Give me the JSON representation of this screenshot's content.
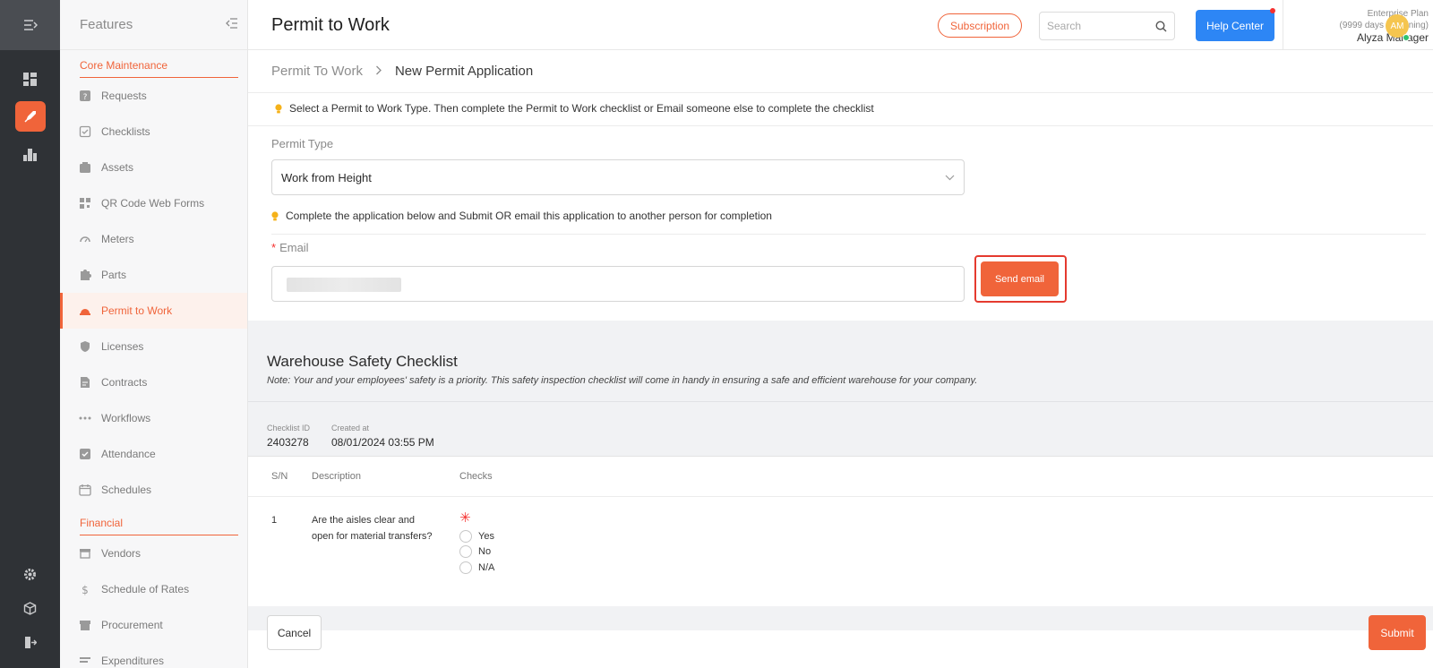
{
  "rail": {
    "menu_icon": "collapse-menu-icon",
    "items": [
      {
        "icon": "dashboard-icon",
        "active": false
      },
      {
        "icon": "rocket-icon",
        "active": true
      },
      {
        "icon": "analytics-icon",
        "active": false
      }
    ],
    "bottom_items": [
      "settings-icon",
      "cube-icon",
      "logout-icon"
    ]
  },
  "sidebar": {
    "title": "Features",
    "sections": [
      {
        "label": "Core Maintenance",
        "items": [
          {
            "label": "Requests",
            "icon": "question-icon"
          },
          {
            "label": "Checklists",
            "icon": "checklist-icon"
          },
          {
            "label": "Assets",
            "icon": "asset-icon"
          },
          {
            "label": "QR Code Web Forms",
            "icon": "qr-code-icon"
          },
          {
            "label": "Meters",
            "icon": "meter-icon"
          },
          {
            "label": "Parts",
            "icon": "puzzle-icon"
          },
          {
            "label": "Permit to Work",
            "icon": "hard-hat-icon",
            "active": true
          },
          {
            "label": "Licenses",
            "icon": "shield-icon"
          },
          {
            "label": "Contracts",
            "icon": "contract-icon"
          },
          {
            "label": "Workflows",
            "icon": "workflow-icon"
          },
          {
            "label": "Attendance",
            "icon": "attendance-icon"
          },
          {
            "label": "Schedules",
            "icon": "calendar-icon"
          }
        ]
      },
      {
        "label": "Financial",
        "items": [
          {
            "label": "Vendors",
            "icon": "vendor-icon"
          },
          {
            "label": "Schedule of Rates",
            "icon": "dollar-icon"
          },
          {
            "label": "Procurement",
            "icon": "store-icon"
          },
          {
            "label": "Expenditures",
            "icon": "expenditure-icon"
          }
        ]
      }
    ]
  },
  "header": {
    "title": "Permit to Work",
    "subscription_label": "Subscription",
    "search_placeholder": "Search",
    "help_label": "Help Center",
    "plan_name": "Enterprise Plan",
    "plan_days": "(9999 days remaining)",
    "user_name": "Alyza Manager",
    "avatar_initials": "AM"
  },
  "breadcrumb": {
    "parent": "Permit To Work",
    "current": "New Permit Application"
  },
  "form": {
    "hint_top": "Select a Permit to Work Type. Then complete the Permit to Work checklist or Email someone else to complete the checklist",
    "permit_type_label": "Permit Type",
    "permit_type_value": "Work from Height",
    "hint_mid": "Complete the application below and Submit OR email this application to another person for completion",
    "email_label": "Email",
    "email_required": "*",
    "send_email_label": "Send email"
  },
  "checklist": {
    "title": "Warehouse Safety Checklist",
    "note": "Note: Your and your employees' safety is a priority. This safety inspection checklist will come in handy in ensuring a safe and efficient warehouse for your company.",
    "id_label": "Checklist ID",
    "id_value": "2403278",
    "created_label": "Created at",
    "created_value": "08/01/2024 03:55 PM",
    "columns": [
      "S/N",
      "Description",
      "Checks"
    ],
    "rows": [
      {
        "sn": "1",
        "description": "Are the aisles clear and open for material transfers?",
        "required_mark": "✳",
        "options": [
          "Yes",
          "No",
          "N/A"
        ]
      }
    ]
  },
  "footer": {
    "cancel_label": "Cancel",
    "submit_label": "Submit"
  },
  "colors": {
    "accent": "#f0643a",
    "help_blue": "#2d86f5",
    "rail_bg": "#2f3236"
  }
}
